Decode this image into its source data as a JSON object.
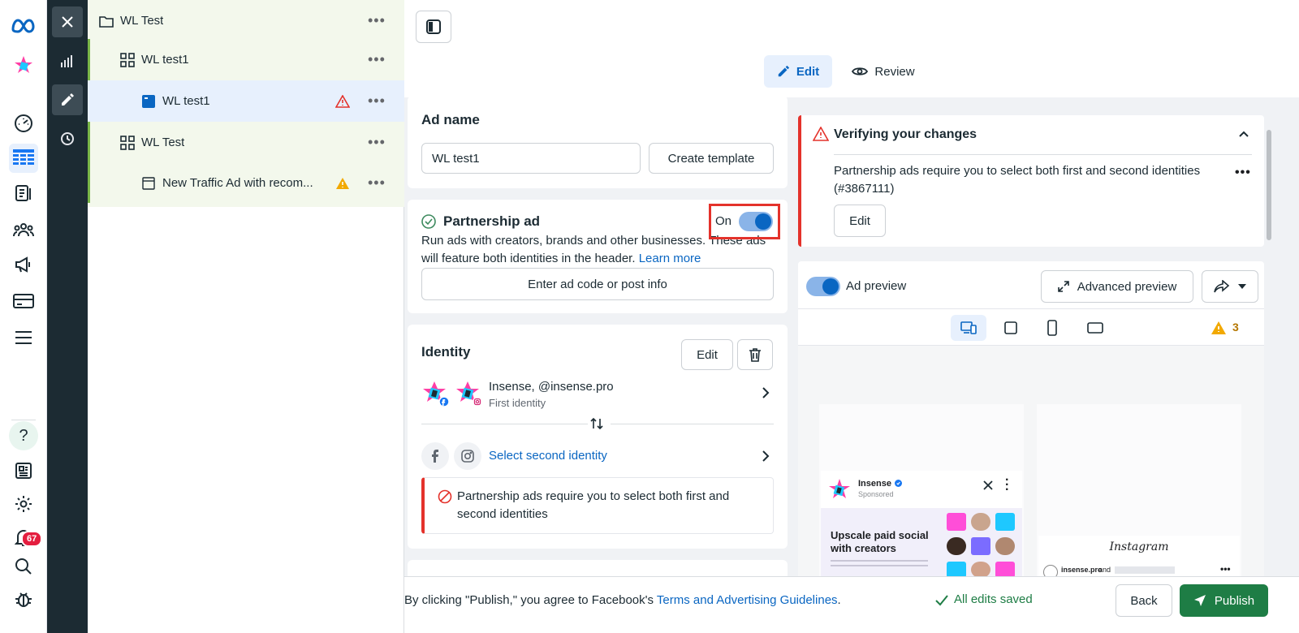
{
  "rail": {
    "notifications_count": "67"
  },
  "tree": {
    "items": [
      {
        "label": "WL Test"
      },
      {
        "label": "WL test1"
      },
      {
        "label": "WL test1"
      },
      {
        "label": "WL Test"
      },
      {
        "label": "New Traffic Ad with recom..."
      }
    ],
    "more": "•••"
  },
  "header": {
    "edit_tab": "Edit",
    "review_tab": "Review"
  },
  "ad_name": {
    "heading": "Ad name",
    "value": "WL test1",
    "create_template": "Create template"
  },
  "partnership": {
    "heading": "Partnership ad",
    "toggle_label": "On",
    "description": "Run ads with creators, brands and other businesses. These ads will feature both identities in the header.",
    "learn_more": "Learn more",
    "enter_code": "Enter ad code or post info"
  },
  "identity": {
    "heading": "Identity",
    "edit": "Edit",
    "first_name": "Insense, @insense.pro",
    "first_sub": "First identity",
    "select_second": "Select second identity",
    "error": "Partnership ads require you to select both first and second identities"
  },
  "verify": {
    "heading": "Verifying your changes",
    "message": "Partnership ads require you to select both first and second identities (#3867111)",
    "edit": "Edit"
  },
  "preview": {
    "label": "Ad preview",
    "advanced": "Advanced preview",
    "warning_count": "3",
    "brand": "Insense",
    "sponsored": "Sponsored",
    "headline": "Upscale paid social with creators",
    "instagram": "Instagram",
    "handle": "insense.pro",
    "and": "and"
  },
  "footer": {
    "terms_prefix": "By clicking \"Publish,\" you agree to Facebook's",
    "terms_link": "Terms and Advertising Guidelines",
    "terms_suffix": ".",
    "saved": "All edits saved",
    "back": "Back",
    "publish": "Publish"
  },
  "colors": {
    "accent": "#0a66c2",
    "publish": "#1e7d45",
    "error": "#e4322b",
    "warning": "#f2a900"
  }
}
